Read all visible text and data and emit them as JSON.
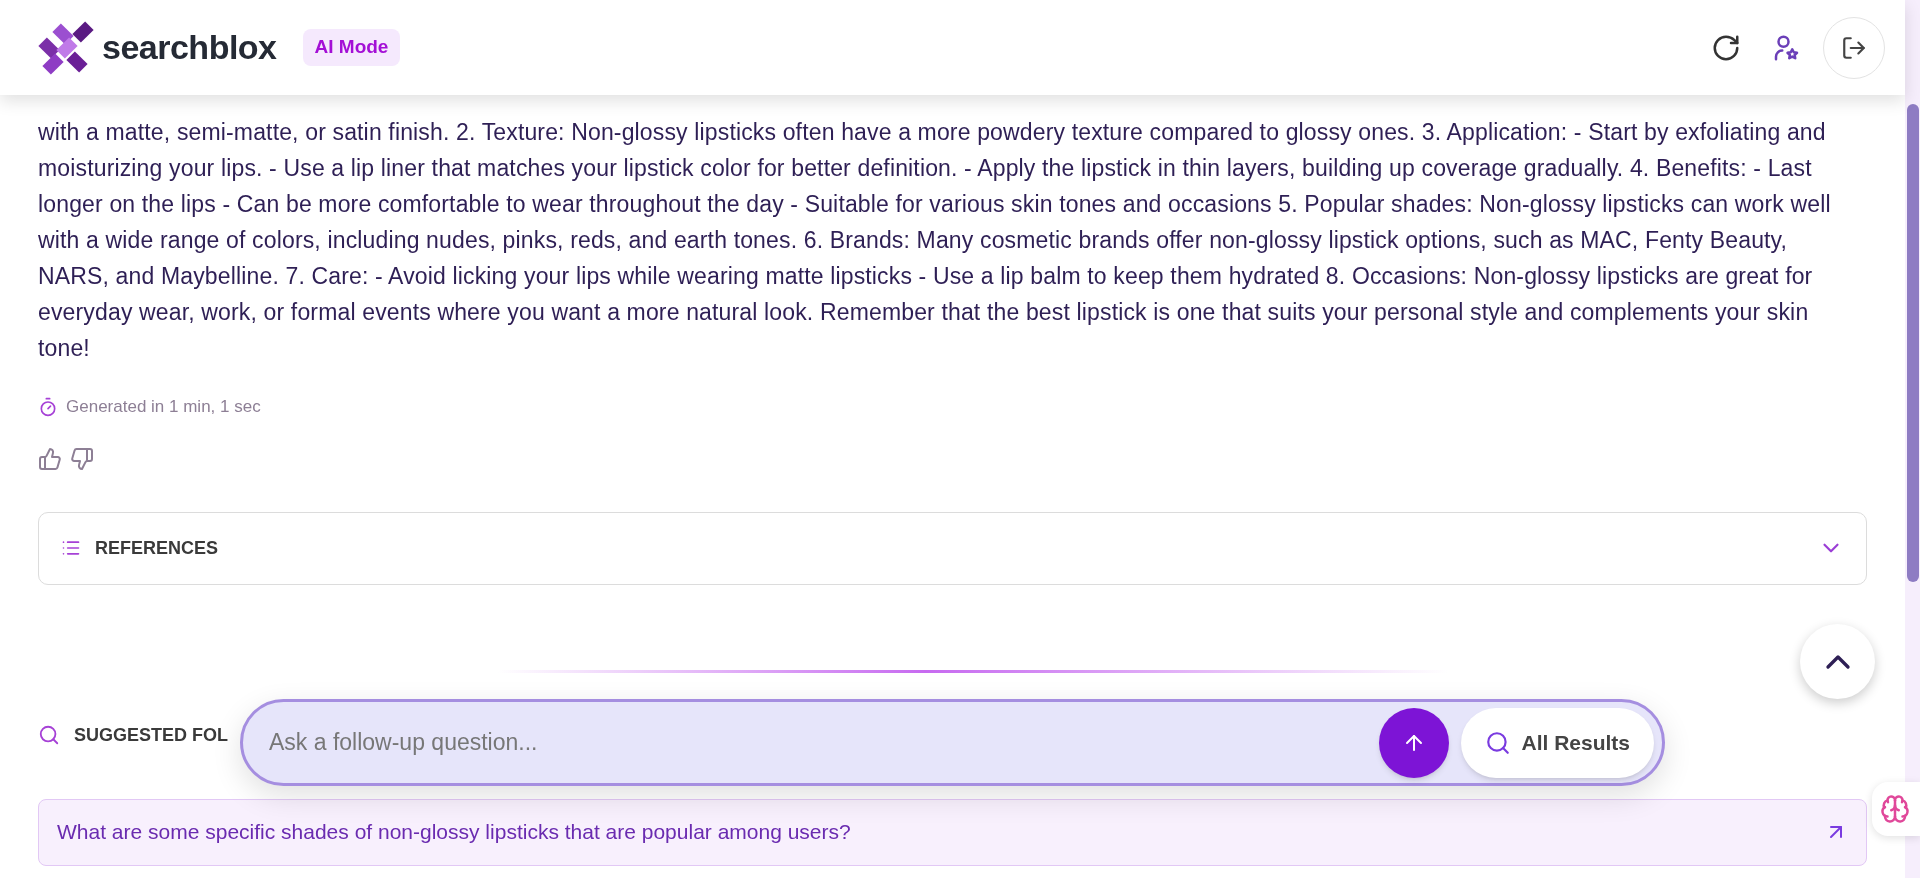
{
  "header": {
    "logo_text": "searchblox",
    "badge": "AI Mode"
  },
  "answer": {
    "text": "with a matte, semi-matte, or satin finish. 2. Texture: Non-glossy lipsticks often have a more powdery texture compared to glossy ones. 3. Application: - Start by exfoliating and moisturizing your lips. - Use a lip liner that matches your lipstick color for better definition. - Apply the lipstick in thin layers, building up coverage gradually. 4. Benefits: - Last longer on the lips - Can be more comfortable to wear throughout the day - Suitable for various skin tones and occasions 5. Popular shades: Non-glossy lipsticks can work well with a wide range of colors, including nudes, pinks, reds, and earth tones. 6. Brands: Many cosmetic brands offer non-glossy lipstick options, such as MAC, Fenty Beauty, NARS, and Maybelline. 7. Care: - Avoid licking your lips while wearing matte lipsticks - Use a lip balm to keep them hydrated 8. Occasions: Non-glossy lipsticks are great for everyday wear, work, or formal events where you want a more natural look. Remember that the best lipstick is one that suits your personal style and complements your skin tone!",
    "generated": "Generated in 1 min, 1 sec"
  },
  "references": {
    "title": "REFERENCES",
    "expanded": false
  },
  "suggested": {
    "title": "SUGGESTED FOL",
    "items": [
      {
        "text": "What are some specific shades of non-glossy lipsticks that are popular among users?"
      }
    ]
  },
  "composer": {
    "placeholder": "Ask a follow-up question...",
    "all_results": "All Results"
  }
}
